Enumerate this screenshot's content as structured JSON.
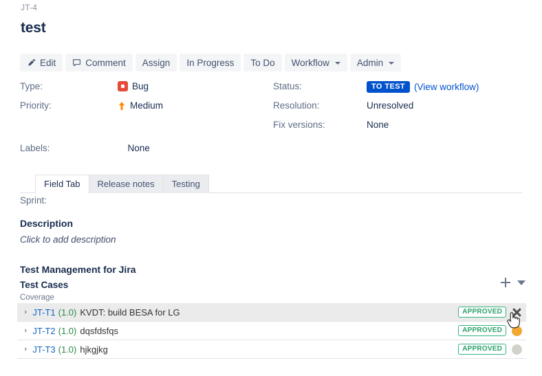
{
  "header": {
    "breadcrumb": "JT-4",
    "title": "test"
  },
  "toolbar": {
    "edit_label": "Edit",
    "comment_label": "Comment",
    "assign_label": "Assign",
    "in_progress_label": "In Progress",
    "to_do_label": "To Do",
    "workflow_label": "Workflow",
    "admin_label": "Admin"
  },
  "fields": {
    "left": [
      {
        "label": "Type:",
        "value": "Bug",
        "icon": "bug-icon"
      },
      {
        "label": "Priority:",
        "value": "Medium",
        "icon": "priority-medium-icon"
      }
    ],
    "right": [
      {
        "label": "Status:",
        "value": "TO TEST",
        "link": "(View workflow)"
      },
      {
        "label": "Resolution:",
        "value": "Unresolved"
      },
      {
        "label": "Fix versions:",
        "value": "None"
      }
    ],
    "labels": {
      "label": "Labels:",
      "value": "None"
    }
  },
  "tabs": [
    {
      "label": "Field Tab",
      "active": true
    },
    {
      "label": "Release notes",
      "active": false
    },
    {
      "label": "Testing",
      "active": false
    }
  ],
  "sprint": {
    "label": "Sprint:"
  },
  "description": {
    "heading": "Description",
    "placeholder": "Click to add description"
  },
  "test_management": {
    "heading": "Test Management for Jira",
    "section_title": "Test Cases",
    "coverage_label": "Coverage",
    "add_icon": "plus-icon",
    "menu_icon": "caret-down-icon",
    "rows": [
      {
        "expander": "›",
        "key": "JT-T1",
        "version": "(1.0)",
        "name": "KVDT: build BESA for LG",
        "status": "APPROVED",
        "indicator": "none",
        "hovered": true,
        "remove_icon": "close-icon"
      },
      {
        "expander": "›",
        "key": "JT-T2",
        "version": "(1.0)",
        "name": "dqsfdsfqs",
        "status": "APPROVED",
        "indicator": "orange",
        "hovered": false
      },
      {
        "expander": "›",
        "key": "JT-T3",
        "version": "(1.0)",
        "name": "hjkgjkg",
        "status": "APPROVED",
        "indicator": "grey",
        "hovered": false
      }
    ]
  },
  "colors": {
    "status_badge": "#0052cc",
    "bug_icon": "#e5493a",
    "priority_icon": "#ff8b00",
    "approved_border": "#36b37e",
    "approved_text": "#2aa06a",
    "indicator_orange": "#f0a830",
    "indicator_grey": "#d2d2cb",
    "link": "#0052cc"
  }
}
